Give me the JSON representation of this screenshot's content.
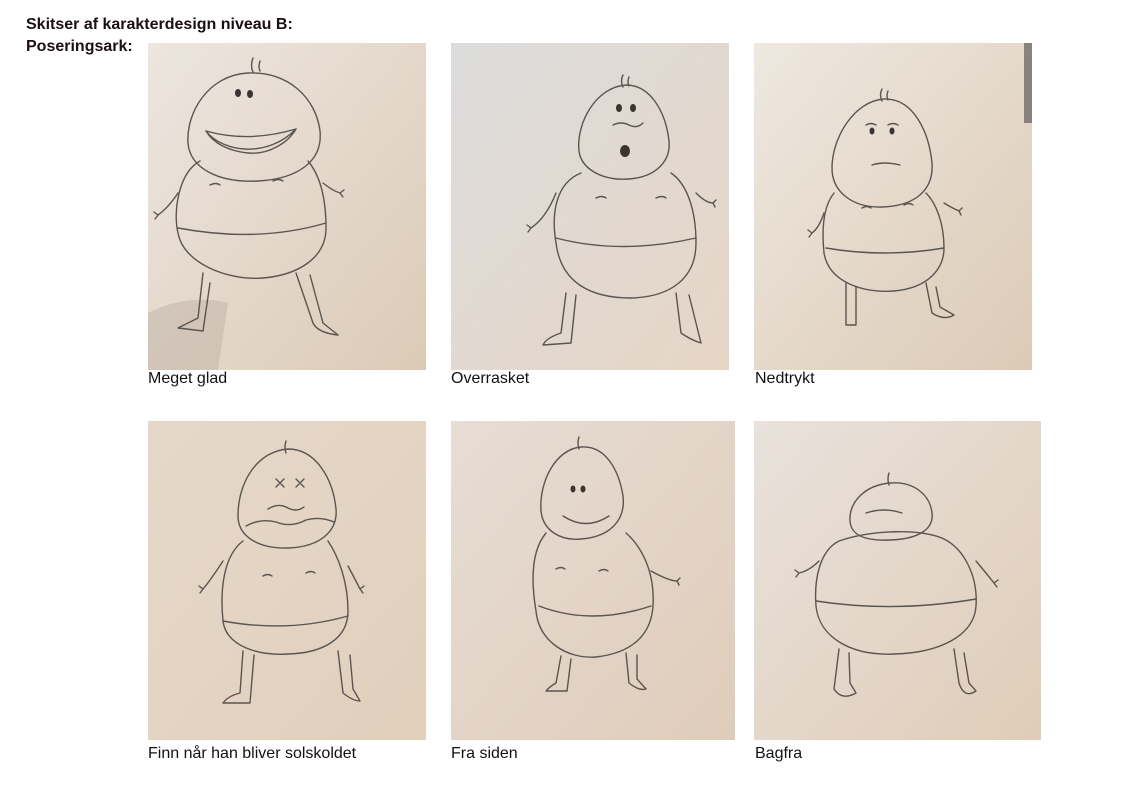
{
  "heading": {
    "line1": "Skitser af karakterdesign niveau B:",
    "line2": "Poseringsark:"
  },
  "sketches": [
    {
      "caption": "Meget glad",
      "icon": "happy-character-sketch",
      "paper": "#e8ddd0"
    },
    {
      "caption": "Overrasket",
      "icon": "surprised-character-sketch",
      "paper": "#e4dcd3"
    },
    {
      "caption": "Nedtrykt",
      "icon": "sad-character-sketch",
      "paper": "#e9ddcf"
    },
    {
      "caption": "Finn når han bliver solskoldet",
      "icon": "sunburnt-character-sketch",
      "paper": "#e6d9ca"
    },
    {
      "caption": "Fra siden",
      "icon": "side-view-character-sketch",
      "paper": "#e7dacb"
    },
    {
      "caption": "Bagfra",
      "icon": "back-view-character-sketch",
      "paper": "#e8dccf"
    }
  ]
}
